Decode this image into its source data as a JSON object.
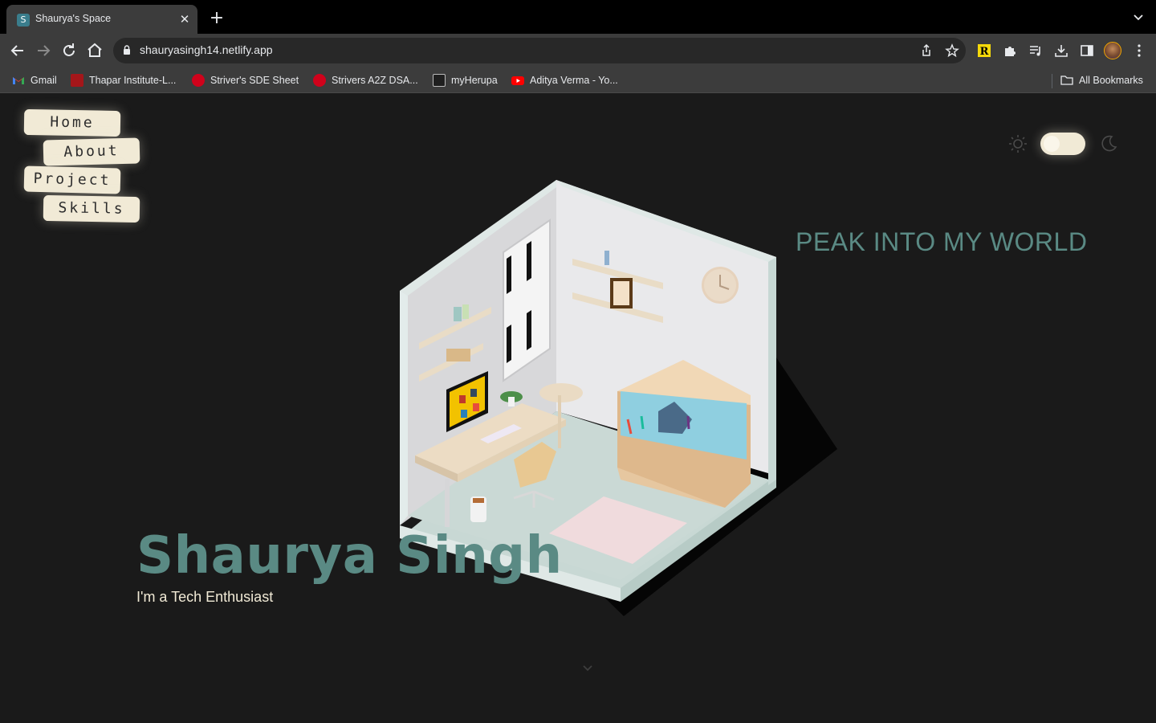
{
  "browser": {
    "tab": {
      "favicon": "S",
      "title": "Shaurya's Space"
    },
    "url": "shauryasingh14.netlify.app",
    "bookmarks": [
      {
        "label": "Gmail",
        "icon": "gmail-icon",
        "color": "#ea4335"
      },
      {
        "label": "Thapar Institute-L...",
        "icon": "thapar-icon",
        "color": "#a4161a"
      },
      {
        "label": "Striver's SDE Sheet",
        "icon": "tuf-icon",
        "color": "#d0021b"
      },
      {
        "label": "Strivers A2Z DSA...",
        "icon": "tuf-icon",
        "color": "#d0021b"
      },
      {
        "label": "myHerupa",
        "icon": "herupa-icon",
        "color": "#1f1f1f"
      },
      {
        "label": "Aditya Verma - Yo...",
        "icon": "youtube-icon",
        "color": "#ff0000"
      }
    ],
    "all_bookmarks": "All Bookmarks"
  },
  "nav": {
    "home": "Home",
    "about": "About",
    "project": "Project",
    "skills": "Skills"
  },
  "theme": {
    "mode": "dark"
  },
  "hero": {
    "tagline": "PEAK INTO MY WORLD",
    "name": "Shaurya Singh",
    "subtitle": "I'm a Tech Enthusiast"
  },
  "colors": {
    "accent": "#5a8a84",
    "cream": "#f1ead6",
    "background": "#1a1a1a"
  }
}
